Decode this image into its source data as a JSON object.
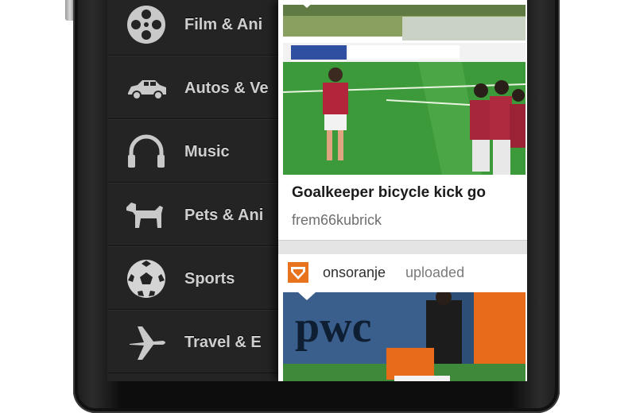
{
  "categories": [
    {
      "label": "Film & Ani",
      "icon": "film-reel-icon"
    },
    {
      "label": "Autos & Ve",
      "icon": "car-icon"
    },
    {
      "label": "Music",
      "icon": "headphones-icon"
    },
    {
      "label": "Pets & Ani",
      "icon": "dog-icon"
    },
    {
      "label": "Sports",
      "icon": "soccer-ball-icon"
    },
    {
      "label": "Travel & E",
      "icon": "airplane-icon"
    }
  ],
  "feed": {
    "video1": {
      "title": "Goalkeeper bicycle kick go",
      "user": "frem66kubrick"
    },
    "video2": {
      "uploader": "onsoranje",
      "action": "uploaded",
      "banner_text": "pwc"
    }
  },
  "colors": {
    "menu_bg": "#242424",
    "menu_text": "#cfcfcf",
    "feed_bg": "#e4e4e4",
    "uploader_logo": "#e8731f"
  }
}
